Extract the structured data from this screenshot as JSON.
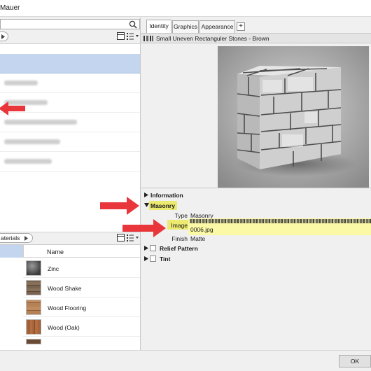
{
  "window": {
    "title": "Mauer"
  },
  "right_panel": {
    "tabs": [
      {
        "label": "Identity",
        "active": true
      },
      {
        "label": "Graphics",
        "active": false
      },
      {
        "label": "Appearance",
        "active": false
      }
    ],
    "add_tab_label": "+",
    "material_name": "Small Uneven Rectanguler Stones - Brown",
    "sections": {
      "information": "Information",
      "masonry": "Masonry",
      "relief_pattern": "Relief Pattern",
      "tint": "Tint"
    },
    "properties": {
      "type_label": "Type",
      "type_value": "Masonry",
      "image_label": "Image",
      "image_value": "0006.jpg",
      "finish_label": "Finish",
      "finish_value": "Matte"
    }
  },
  "left_panel": {
    "materials_tab_label": "aterials",
    "materials_column_header": "Name",
    "materials": [
      {
        "name": "Zinc",
        "swatch_color": "#5a5a5a"
      },
      {
        "name": "Wood Shake",
        "swatch_color": "#6e5a46"
      },
      {
        "name": "Wood Flooring",
        "swatch_color": "#a8754b"
      },
      {
        "name": "Wood (Oak)",
        "swatch_color": "#9a5a32"
      }
    ],
    "collapse_glyph": "«"
  },
  "footer": {
    "ok_label": "OK"
  },
  "colors": {
    "selection": "#c3d5ef",
    "highlight": "#ecea70",
    "annotation_arrow": "#e8363a",
    "link_blue": "#4b6ea6"
  }
}
